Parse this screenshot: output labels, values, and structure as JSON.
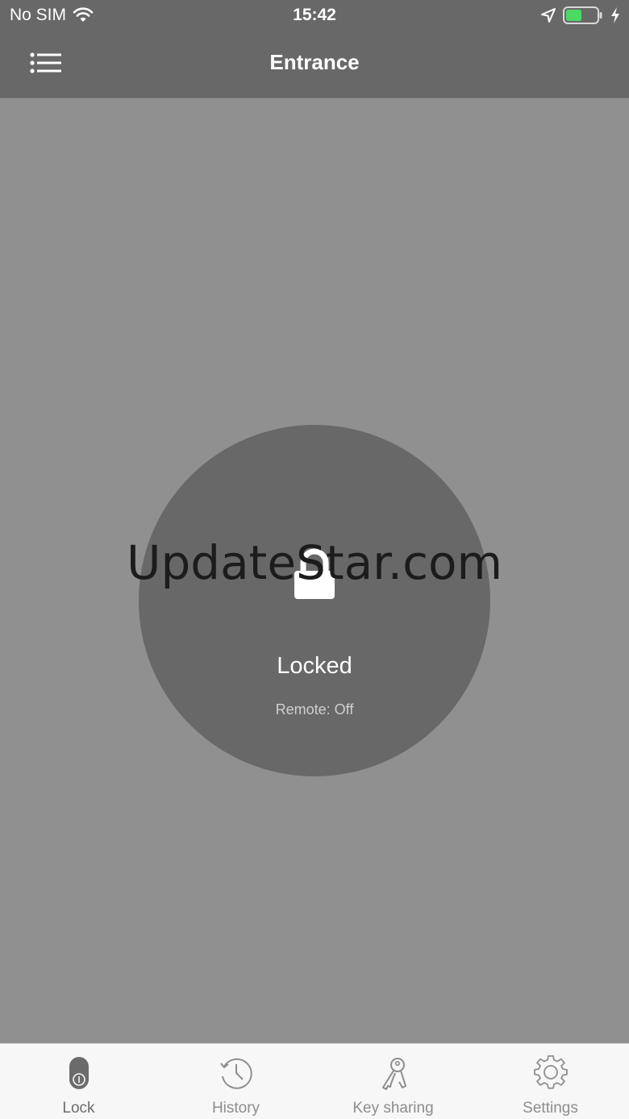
{
  "status_bar": {
    "carrier": "No SIM",
    "time": "15:42",
    "icons": [
      "wifi-icon",
      "location-arrow-icon",
      "battery-icon",
      "charging-bolt-icon"
    ],
    "battery_color": "#4cd964"
  },
  "nav": {
    "title": "Entrance",
    "menu_icon": "list-menu-icon"
  },
  "lock": {
    "status": "Locked",
    "remote": "Remote: Off",
    "icon": "padlock-icon"
  },
  "watermark": "UpdateStar.com",
  "tabs": [
    {
      "label": "Lock",
      "icon": "lock-tab-icon",
      "active": true
    },
    {
      "label": "History",
      "icon": "history-clock-icon",
      "active": false
    },
    {
      "label": "Key sharing",
      "icon": "key-sharing-icon",
      "active": false
    },
    {
      "label": "Settings",
      "icon": "gear-icon",
      "active": false
    }
  ],
  "colors": {
    "bar": "#686868",
    "background": "#909090",
    "circle": "#686868",
    "tabbar": "#f7f7f7"
  }
}
